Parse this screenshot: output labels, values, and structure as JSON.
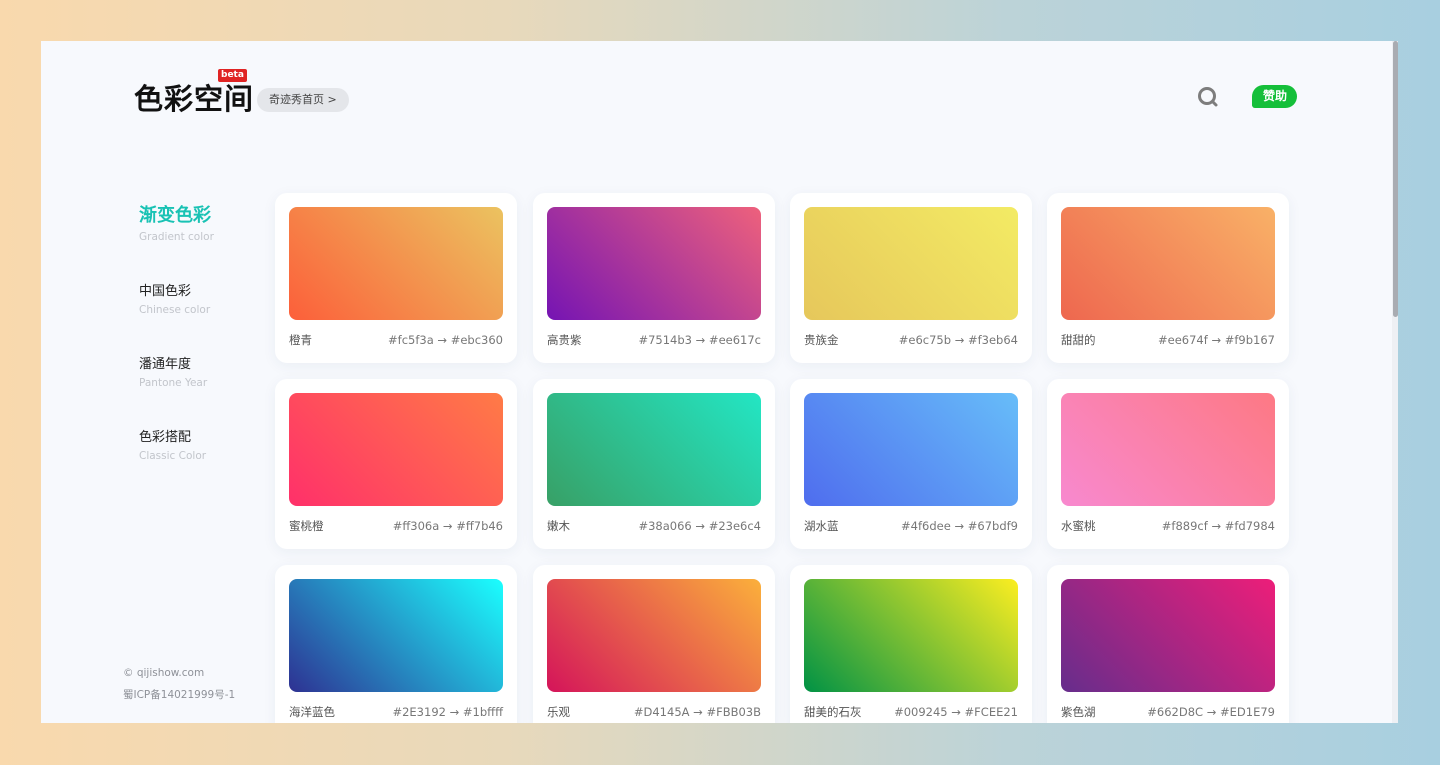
{
  "header": {
    "logo": "色彩空间",
    "badge": "beta",
    "home_link": "奇迹秀首页 >",
    "sponsor": "赞助"
  },
  "icons": {
    "search": "search-icon"
  },
  "nav": [
    {
      "title": "渐变色彩",
      "subtitle": "Gradient color",
      "active": true
    },
    {
      "title": "中国色彩",
      "subtitle": "Chinese color",
      "active": false
    },
    {
      "title": "潘通年度",
      "subtitle": "Pantone Year",
      "active": false
    },
    {
      "title": "色彩搭配",
      "subtitle": "Classic Color",
      "active": false
    }
  ],
  "footer": {
    "site": "© qijishow.com",
    "icp": "蜀ICP备14021999号-1"
  },
  "colors": {
    "accent": "#19c2b4",
    "sponsor": "#15bf3a",
    "badge": "#e02424"
  },
  "cards": [
    {
      "name": "橙青",
      "code": "#fc5f3a → #ebc360",
      "from": "#fc5f3a",
      "to": "#ebc360"
    },
    {
      "name": "高贵紫",
      "code": "#7514b3 → #ee617c",
      "from": "#7514b3",
      "to": "#ee617c"
    },
    {
      "name": "贵族金",
      "code": "#e6c75b → #f3eb64",
      "from": "#e6c75b",
      "to": "#f3eb64"
    },
    {
      "name": "甜甜的",
      "code": "#ee674f → #f9b167",
      "from": "#ee674f",
      "to": "#f9b167"
    },
    {
      "name": "蜜桃橙",
      "code": "#ff306a → #ff7b46",
      "from": "#ff306a",
      "to": "#ff7b46"
    },
    {
      "name": "嫩木",
      "code": "#38a066 → #23e6c4",
      "from": "#38a066",
      "to": "#23e6c4"
    },
    {
      "name": "湖水蓝",
      "code": "#4f6dee → #67bdf9",
      "from": "#4f6dee",
      "to": "#67bdf9"
    },
    {
      "name": "水蜜桃",
      "code": "#f889cf → #fd7984",
      "from": "#f889cf",
      "to": "#fd7984"
    },
    {
      "name": "海洋蓝色",
      "code": "#2E3192 → #1bffff",
      "from": "#2E3192",
      "to": "#1bffff"
    },
    {
      "name": "乐观",
      "code": "#D4145A → #FBB03B",
      "from": "#D4145A",
      "to": "#FBB03B"
    },
    {
      "name": "甜美的石灰",
      "code": "#009245 → #FCEE21",
      "from": "#009245",
      "to": "#FCEE21"
    },
    {
      "name": "紫色湖",
      "code": "#662D8C → #ED1E79",
      "from": "#662D8C",
      "to": "#ED1E79"
    }
  ]
}
